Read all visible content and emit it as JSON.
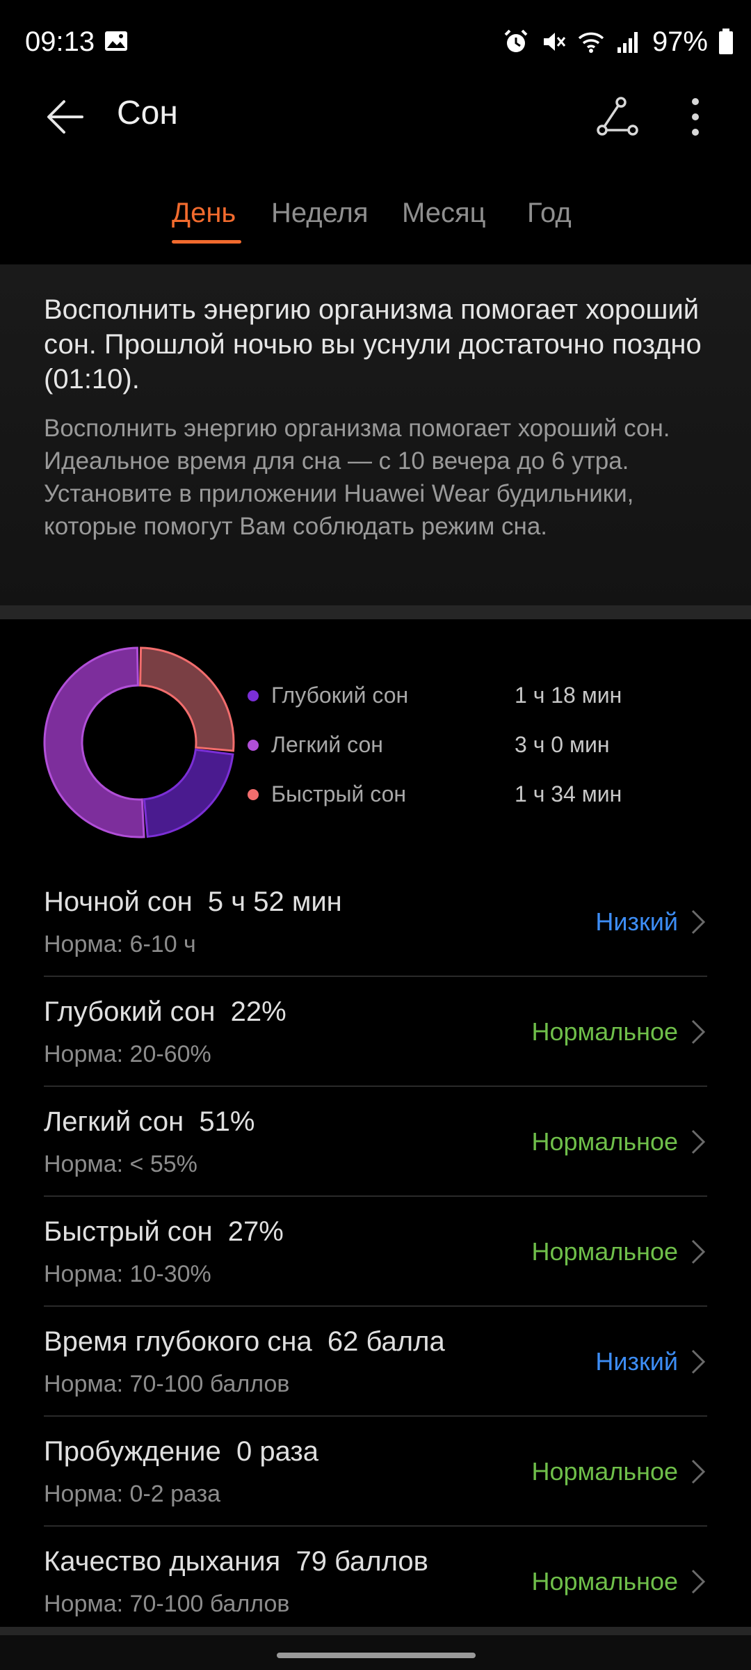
{
  "status_bar": {
    "time": "09:13",
    "battery": "97%",
    "icons": [
      "gallery-icon",
      "alarm-icon",
      "mute-icon",
      "wifi-icon",
      "signal-icon",
      "battery-icon"
    ]
  },
  "header": {
    "title": "Сон",
    "back_icon": "back-arrow-icon",
    "share_icon": "share-icon",
    "more_icon": "more-vertical-icon"
  },
  "tabs": [
    {
      "label": "День",
      "active": true
    },
    {
      "label": "Неделя",
      "active": false
    },
    {
      "label": "Месяц",
      "active": false
    },
    {
      "label": "Год",
      "active": false
    }
  ],
  "advice": {
    "title": "Восполнить энергию организма помогает хороший сон. Прошлой ночью вы уснули достаточно поздно (01:10).",
    "body": "Восполнить энергию организма помогает хороший сон. Идеальное время для сна — с 10 вечера до 6 утра. Установите в приложении Huawei Wear будильники, которые помогут Вам соблюдать режим сна."
  },
  "chart_data": {
    "type": "pie",
    "donut": true,
    "series": [
      {
        "name": "Глубокий сон",
        "value": 78,
        "display": "1 ч 18 мин",
        "color": "#7b2fd6"
      },
      {
        "name": "Легкий сон",
        "value": 180,
        "display": "3 ч 0 мин",
        "color": "#b14fd8"
      },
      {
        "name": "Быстрый сон",
        "value": 94,
        "display": "1 ч 34 мин",
        "color": "#f26d6d"
      }
    ]
  },
  "metrics": [
    {
      "title": "Ночной сон  5 ч 52 мин",
      "norm": "Норма: 6-10 ч",
      "status": "Низкий",
      "status_color": "#3d8df5"
    },
    {
      "title": "Глубокий сон  22%",
      "norm": "Норма: 20-60%",
      "status": "Нормальное",
      "status_color": "#6fbf4a"
    },
    {
      "title": "Легкий сон  51%",
      "norm": "Норма: < 55%",
      "status": "Нормальное",
      "status_color": "#6fbf4a"
    },
    {
      "title": "Быстрый сон  27%",
      "norm": "Норма: 10-30%",
      "status": "Нормальное",
      "status_color": "#6fbf4a"
    },
    {
      "title": "Время глубокого сна  62 балла",
      "norm": "Норма: 70-100 баллов",
      "status": "Низкий",
      "status_color": "#3d8df5"
    },
    {
      "title": "Пробуждение  0 раза",
      "norm": "Норма: 0-2 раза",
      "status": "Нормальное",
      "status_color": "#6fbf4a"
    },
    {
      "title": "Качество дыхания  79 баллов",
      "norm": "Норма: 70-100 баллов",
      "status": "Нормальное",
      "status_color": "#6fbf4a"
    }
  ]
}
